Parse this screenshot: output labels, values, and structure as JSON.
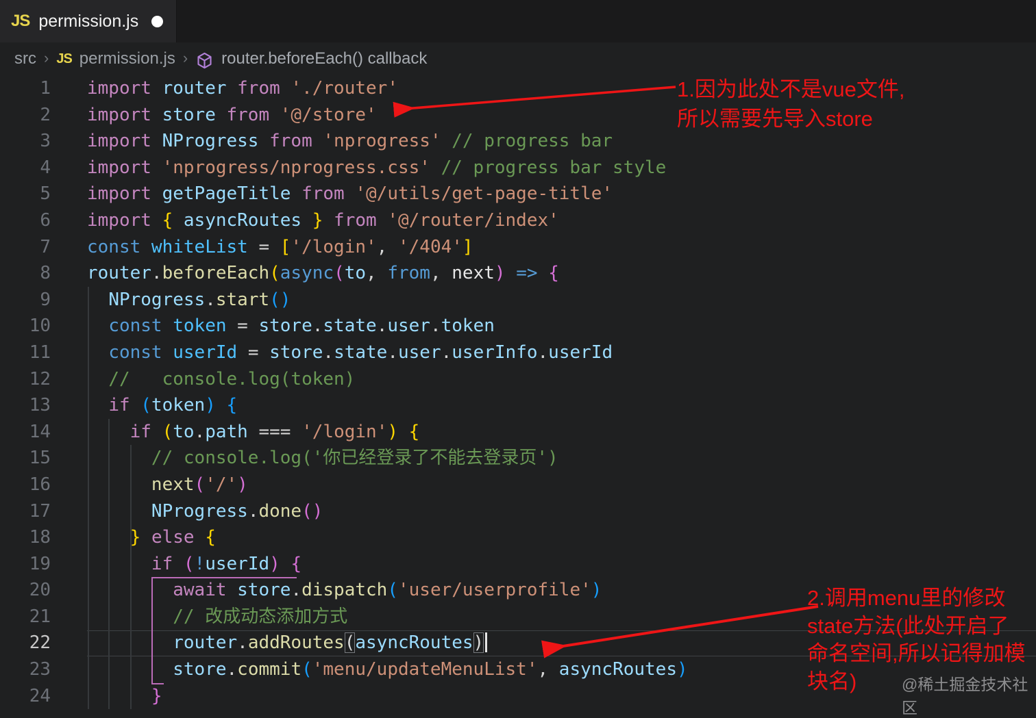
{
  "colors": {
    "accent_red": "#ee1516",
    "symbol_purple": "#b180d7",
    "tokens": {
      "kw": "#C586C0",
      "decl": "#569CD6",
      "var": "#9CDCFE",
      "cvar": "#4FC1FF",
      "fn": "#DCDCAA",
      "str": "#CE9178",
      "com": "#6A9955",
      "op": "#D4D4D4",
      "b1": "#FFD700",
      "b2": "#D670D6",
      "b3": "#179FFF",
      "bx": "#D8D8D8",
      "wh": "#E6E6E6"
    }
  },
  "tab": {
    "icon": "JS",
    "filename": "permission.js",
    "modified_dot": "●"
  },
  "breadcrumb": {
    "root": "src",
    "separator": "›",
    "file_icon": "JS",
    "file": "permission.js",
    "symbol_icon": "cube",
    "symbol": "router.beforeEach() callback"
  },
  "editor": {
    "lines": [
      {
        "num": "1",
        "tokens": [
          [
            "kw",
            "import "
          ],
          [
            "var",
            "router "
          ],
          [
            "kw",
            "from "
          ],
          [
            "str",
            "'./router'"
          ]
        ]
      },
      {
        "num": "2",
        "tokens": [
          [
            "kw",
            "import "
          ],
          [
            "var",
            "store "
          ],
          [
            "kw",
            "from "
          ],
          [
            "str",
            "'@/store'"
          ]
        ]
      },
      {
        "num": "3",
        "tokens": [
          [
            "kw",
            "import "
          ],
          [
            "var",
            "NProgress "
          ],
          [
            "kw",
            "from "
          ],
          [
            "str",
            "'nprogress' "
          ],
          [
            "com",
            "// progress bar"
          ]
        ]
      },
      {
        "num": "4",
        "tokens": [
          [
            "kw",
            "import "
          ],
          [
            "str",
            "'nprogress/nprogress.css' "
          ],
          [
            "com",
            "// progress bar style"
          ]
        ]
      },
      {
        "num": "5",
        "tokens": [
          [
            "kw",
            "import "
          ],
          [
            "var",
            "getPageTitle "
          ],
          [
            "kw",
            "from "
          ],
          [
            "str",
            "'@/utils/get-page-title'"
          ]
        ]
      },
      {
        "num": "6",
        "tokens": [
          [
            "kw",
            "import "
          ],
          [
            "b1",
            "{ "
          ],
          [
            "var",
            "asyncRoutes "
          ],
          [
            "b1",
            "} "
          ],
          [
            "kw",
            "from "
          ],
          [
            "str",
            "'@/router/index'"
          ]
        ]
      },
      {
        "num": "7",
        "tokens": [
          [
            "decl",
            "const "
          ],
          [
            "cvar",
            "whiteList "
          ],
          [
            "op",
            "= "
          ],
          [
            "b1",
            "["
          ],
          [
            "str",
            "'/login'"
          ],
          [
            "op",
            ", "
          ],
          [
            "str",
            "'/404'"
          ],
          [
            "b1",
            "]"
          ]
        ]
      },
      {
        "num": "8",
        "tokens": [
          [
            "var",
            "router"
          ],
          [
            "op",
            "."
          ],
          [
            "fn",
            "beforeEach"
          ],
          [
            "b1",
            "("
          ],
          [
            "decl",
            "async"
          ],
          [
            "b2",
            "("
          ],
          [
            "var",
            "to"
          ],
          [
            "op",
            ", "
          ],
          [
            "decl",
            "from"
          ],
          [
            "op",
            ", "
          ],
          [
            "wh",
            "next"
          ],
          [
            "b2",
            ")"
          ],
          [
            "decl",
            " => "
          ],
          [
            "b2",
            "{"
          ]
        ]
      },
      {
        "num": "9",
        "tokens": [
          [
            "sp",
            "  "
          ],
          [
            "var",
            "NProgress"
          ],
          [
            "op",
            "."
          ],
          [
            "fn",
            "start"
          ],
          [
            "b3",
            "()"
          ]
        ]
      },
      {
        "num": "10",
        "tokens": [
          [
            "sp",
            "  "
          ],
          [
            "decl",
            "const "
          ],
          [
            "cvar",
            "token "
          ],
          [
            "op",
            "= "
          ],
          [
            "var",
            "store"
          ],
          [
            "op",
            "."
          ],
          [
            "var",
            "state"
          ],
          [
            "op",
            "."
          ],
          [
            "var",
            "user"
          ],
          [
            "op",
            "."
          ],
          [
            "var",
            "token"
          ]
        ]
      },
      {
        "num": "11",
        "tokens": [
          [
            "sp",
            "  "
          ],
          [
            "decl",
            "const "
          ],
          [
            "cvar",
            "userId "
          ],
          [
            "op",
            "= "
          ],
          [
            "var",
            "store"
          ],
          [
            "op",
            "."
          ],
          [
            "var",
            "state"
          ],
          [
            "op",
            "."
          ],
          [
            "var",
            "user"
          ],
          [
            "op",
            "."
          ],
          [
            "var",
            "userInfo"
          ],
          [
            "op",
            "."
          ],
          [
            "var",
            "userId"
          ]
        ]
      },
      {
        "num": "12",
        "tokens": [
          [
            "sp",
            "  "
          ],
          [
            "com",
            "//   console.log(token)"
          ]
        ]
      },
      {
        "num": "13",
        "tokens": [
          [
            "sp",
            "  "
          ],
          [
            "kw",
            "if "
          ],
          [
            "b3",
            "("
          ],
          [
            "var",
            "token"
          ],
          [
            "b3",
            ") "
          ],
          [
            "b3",
            "{"
          ]
        ]
      },
      {
        "num": "14",
        "tokens": [
          [
            "sp",
            "    "
          ],
          [
            "kw",
            "if "
          ],
          [
            "b1",
            "("
          ],
          [
            "var",
            "to"
          ],
          [
            "op",
            "."
          ],
          [
            "var",
            "path "
          ],
          [
            "op",
            "=== "
          ],
          [
            "str",
            "'/login'"
          ],
          [
            "b1",
            ") "
          ],
          [
            "b1",
            "{"
          ]
        ]
      },
      {
        "num": "15",
        "tokens": [
          [
            "sp",
            "      "
          ],
          [
            "com",
            "// console.log('你已经登录了不能去登录页')"
          ]
        ]
      },
      {
        "num": "16",
        "tokens": [
          [
            "sp",
            "      "
          ],
          [
            "fn",
            "next"
          ],
          [
            "b2",
            "("
          ],
          [
            "str",
            "'/'"
          ],
          [
            "b2",
            ")"
          ]
        ]
      },
      {
        "num": "17",
        "tokens": [
          [
            "sp",
            "      "
          ],
          [
            "var",
            "NProgress"
          ],
          [
            "op",
            "."
          ],
          [
            "fn",
            "done"
          ],
          [
            "b2",
            "()"
          ]
        ]
      },
      {
        "num": "18",
        "tokens": [
          [
            "sp",
            "    "
          ],
          [
            "b1",
            "} "
          ],
          [
            "kw",
            "else "
          ],
          [
            "b1",
            "{"
          ]
        ]
      },
      {
        "num": "19",
        "tokens": [
          [
            "sp",
            "      "
          ],
          [
            "kw",
            "if "
          ],
          [
            "b2",
            "("
          ],
          [
            "decl",
            "!"
          ],
          [
            "var",
            "userId"
          ],
          [
            "b2",
            ") "
          ],
          [
            "b2",
            "{"
          ]
        ]
      },
      {
        "num": "20",
        "tokens": [
          [
            "sp",
            "        "
          ],
          [
            "kw",
            "await "
          ],
          [
            "var",
            "store"
          ],
          [
            "op",
            "."
          ],
          [
            "fn",
            "dispatch"
          ],
          [
            "b3",
            "("
          ],
          [
            "str",
            "'user/userprofile'"
          ],
          [
            "b3",
            ")"
          ]
        ]
      },
      {
        "num": "21",
        "tokens": [
          [
            "sp",
            "        "
          ],
          [
            "com",
            "// 改成动态添加方式"
          ]
        ]
      },
      {
        "num": "22",
        "active": true,
        "cursor": true,
        "tokens": [
          [
            "sp",
            "        "
          ],
          [
            "var",
            "router"
          ],
          [
            "op",
            "."
          ],
          [
            "fn",
            "addRoutes"
          ],
          [
            "bx",
            "("
          ],
          [
            "var",
            "asyncRoutes"
          ],
          [
            "bx",
            ")"
          ]
        ]
      },
      {
        "num": "23",
        "tokens": [
          [
            "sp",
            "        "
          ],
          [
            "var",
            "store"
          ],
          [
            "op",
            "."
          ],
          [
            "fn",
            "commit"
          ],
          [
            "b3",
            "("
          ],
          [
            "str",
            "'menu/updateMenuList'"
          ],
          [
            "op",
            ", "
          ],
          [
            "var",
            "asyncRoutes"
          ],
          [
            "b3",
            ")"
          ]
        ]
      },
      {
        "num": "24",
        "tokens": [
          [
            "sp",
            "      "
          ],
          [
            "b2",
            "}"
          ]
        ]
      }
    ]
  },
  "annotations": {
    "note1": {
      "lines": [
        "1.因为此处不是vue文件,",
        "所以需要先导入store"
      ]
    },
    "note2": {
      "lines": [
        "2.调用menu里的修改",
        "state方法(此处开启了",
        "命名空间,所以记得加模",
        "块名)"
      ]
    }
  },
  "watermark": "@稀土掘金技术社区"
}
